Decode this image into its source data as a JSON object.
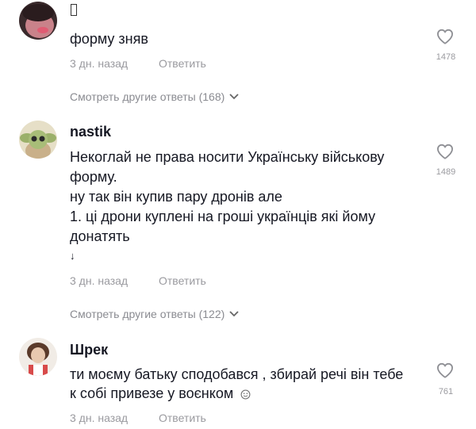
{
  "comments": [
    {
      "username": "",
      "lines": [
        "форму зняв"
      ],
      "time": "3 дн. назад",
      "reply_label": "Ответить",
      "likes": "1478",
      "more_replies": "Смотреть другие ответы (168)"
    },
    {
      "username": "nastik",
      "lines": [
        "Некоглай не права носити Українську військову",
        "форму.",
        "ну так він купив пару дронів але",
        "1. ці дрони куплені на гроші українців які йому",
        "донатять",
        "↓"
      ],
      "time": "3 дн. назад",
      "reply_label": "Ответить",
      "likes": "1489",
      "more_replies": "Смотреть другие ответы (122)"
    },
    {
      "username": "Шрек",
      "lines": [
        "ти моєму батьку сподобався , збирай речі він тебе",
        "к собі привезе у воєнком"
      ],
      "time": "3 дн. назад",
      "reply_label": "Ответить",
      "likes": "761"
    }
  ],
  "icons": {
    "like": "heart-outline-icon",
    "more": "chevron-down-icon",
    "emoji": "smiley-icon"
  },
  "colors": {
    "text": "#161823",
    "meta": "#9a9a9f",
    "background": "#ffffff"
  }
}
